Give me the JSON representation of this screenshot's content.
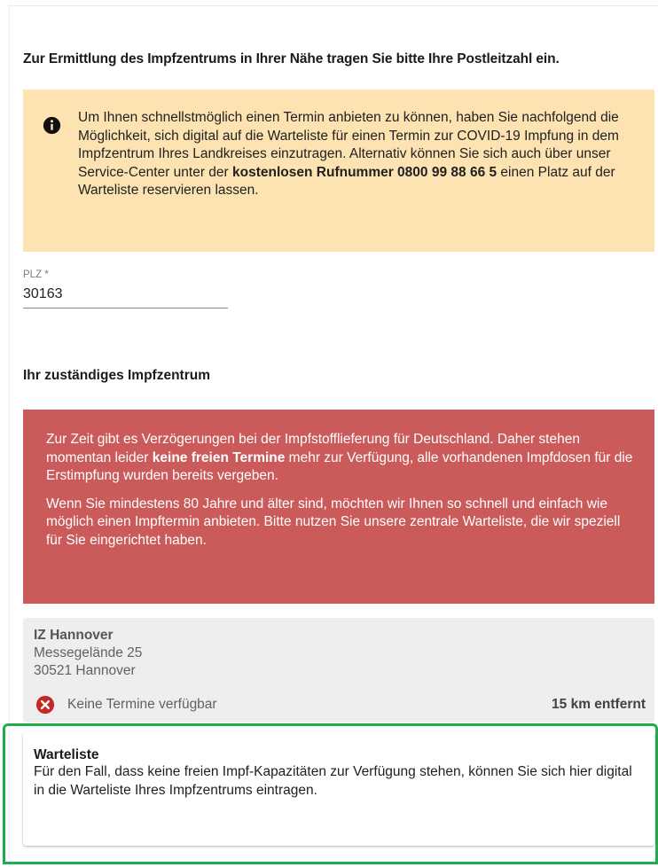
{
  "intro_text": "Zur Ermittlung des Impfzentrums in Ihrer Nähe tragen Sie bitte Ihre Postleitzahl ein.",
  "info_box": {
    "icon": "info-icon",
    "text_before": "Um Ihnen schnellstmöglich einen Termin anbieten zu können, haben Sie nachfolgend die Möglichkeit, sich digital auf die Warteliste für einen Termin zur COVID-19 Impfung in dem Impfzentrum Ihres Landkreises einzutragen. Alternativ können Sie sich auch über unser Service-Center unter der ",
    "hotline_bold": "kostenlosen Rufnummer 0800 99 88 66 5",
    "text_after": " einen Platz auf der Warteliste reservieren lassen.",
    "background_color": "#fde3b1"
  },
  "plz_field": {
    "label": "PLZ *",
    "value": "30163"
  },
  "section_title": "Ihr zuständiges Impfzentrum",
  "alert": {
    "background_color": "#cb5a5a",
    "p1_before": "Zur Zeit gibt es Verzögerungen bei der Impfstofflieferung für Deutschland. Daher stehen momentan leider ",
    "p1_bold": "keine freien Termine",
    "p1_after": " mehr zur Verfügung, alle vorhandenen Impfdosen für die Erstimpfung wurden bereits vergeben.",
    "p2": "Wenn Sie mindestens 80 Jahre und älter sind, möchten wir Ihnen so schnell und einfach wie möglich einen Impftermin anbieten. Bitte nutzen Sie unsere zentrale Warteliste, die wir speziell für Sie eingerichtet haben."
  },
  "vaccination_center": {
    "name": "IZ Hannover",
    "street": "Messegelände 25",
    "city": "30521 Hannover",
    "status_icon": "error-x-icon",
    "status": "Keine Termine verfügbar",
    "distance": "15 km entfernt",
    "status_color": "#c62828"
  },
  "waitlist": {
    "title": "Warteliste",
    "description": "Für den Fall, dass keine freien Impf-Kapazitäten zur Verfügung stehen, können Sie sich hier digital in die Warteliste Ihres Impfzentrums eintragen.",
    "highlight_color": "#1fad4f"
  }
}
